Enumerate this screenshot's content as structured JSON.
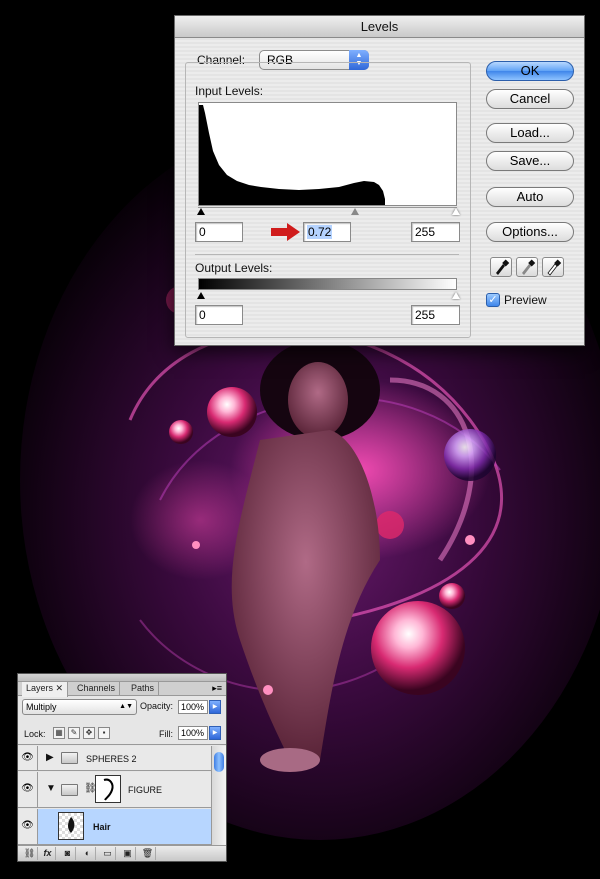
{
  "levels_dialog": {
    "title": "Levels",
    "channel_label": "Channel:",
    "channel_value": "RGB",
    "input_levels_label": "Input Levels:",
    "input_black": "0",
    "input_gamma": "0.72",
    "input_white": "255",
    "output_levels_label": "Output Levels:",
    "output_black": "0",
    "output_white": "255",
    "buttons": {
      "ok": "OK",
      "cancel": "Cancel",
      "load": "Load...",
      "save": "Save...",
      "auto": "Auto",
      "options": "Options..."
    },
    "preview_label": "Preview",
    "preview_checked": true,
    "accent_color": "#3f86ea",
    "arrow_color": "#d01c1c"
  },
  "layers_panel": {
    "tabs": [
      "Layers",
      "Channels",
      "Paths"
    ],
    "active_tab": "Layers",
    "blend_mode": "Multiply",
    "opacity_label": "Opacity:",
    "opacity_value": "100%",
    "lock_label": "Lock:",
    "fill_label": "Fill:",
    "fill_value": "100%",
    "layers": [
      {
        "name": "SPHERES 2",
        "type": "group",
        "expanded": false,
        "visible": true
      },
      {
        "name": "FIGURE",
        "type": "group",
        "expanded": true,
        "visible": true,
        "has_mask": true
      },
      {
        "name": "Hair",
        "type": "layer",
        "selected": true,
        "visible": true
      }
    ]
  },
  "icons": {
    "eye": "eye-icon",
    "folder": "folder-icon",
    "link": "link-icon",
    "eyedropper": "eyedropper-icon",
    "arrow": "red-arrow-icon"
  }
}
